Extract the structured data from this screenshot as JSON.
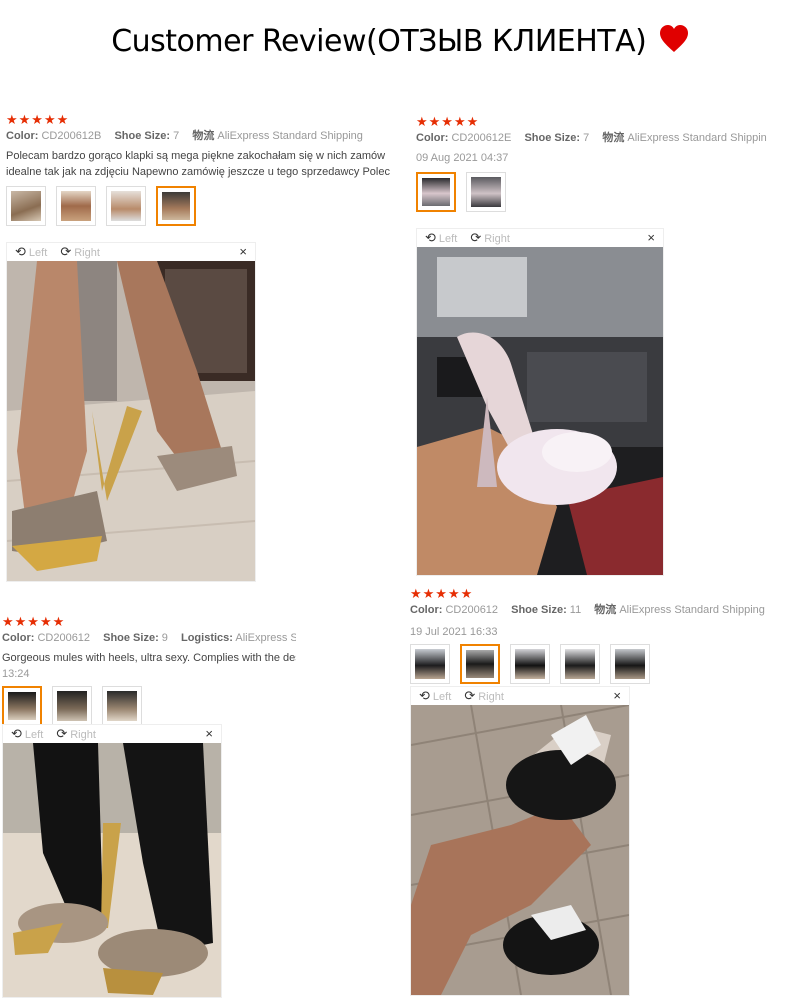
{
  "header": {
    "title": "Customer Review(ОТЗЫВ КЛИЕНТА)",
    "heart_color": "#e00000"
  },
  "viewer_labels": {
    "left": "Left",
    "right": "Right",
    "close": "×"
  },
  "reviews": [
    {
      "stars": "★★★★★",
      "color_label": "Color:",
      "color_value": "CD200612B",
      "size_label": "Shoe Size:",
      "size_value": "7",
      "shipping_label": "物流",
      "shipping_value": "AliExpress Standard Shipping",
      "text_line1": "Polecam bardzo gorąco klapki są mega piękne zakochałam się w nich zamów",
      "text_line2": "idealne tak jak na zdjęciu Napewno zamówię jeszcze u tego sprzedawcy Polec"
    },
    {
      "stars": "★★★★★",
      "color_label": "Color:",
      "color_value": "CD200612E",
      "size_label": "Shoe Size:",
      "size_value": "7",
      "shipping_label": "物流",
      "shipping_value": "AliExpress Standard Shippin",
      "date": "09 Aug 2021 04:37"
    },
    {
      "stars": "★★★★★",
      "color_label": "Color:",
      "color_value": "CD200612",
      "size_label": "Shoe Size:",
      "size_value": "9",
      "shipping_label": "Logistics:",
      "shipping_value": "AliExpress Standard",
      "text_line1": "Gorgeous mules with heels, ultra sexy. Complies with the descri",
      "date": "13:24"
    },
    {
      "stars": "★★★★★",
      "color_label": "Color:",
      "color_value": "CD200612",
      "size_label": "Shoe Size:",
      "size_value": "11",
      "shipping_label": "物流",
      "shipping_value": "AliExpress Standard Shipping",
      "date": "19 Jul 2021 16:33"
    }
  ]
}
